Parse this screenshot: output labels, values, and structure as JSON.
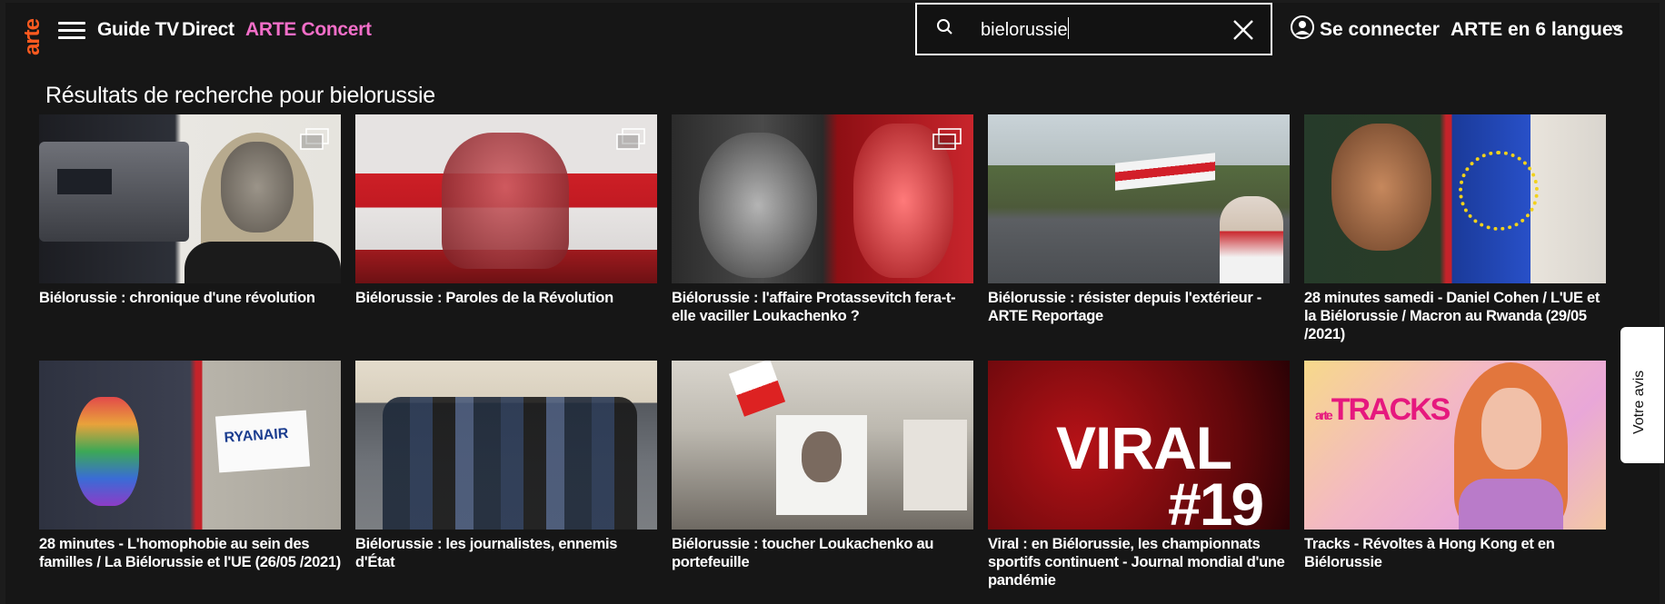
{
  "header": {
    "logo": "arte",
    "nav": [
      "Guide TV",
      "Direct",
      "ARTE Concert"
    ],
    "search_value": "bielorussie",
    "connect_label": "Se connecter",
    "lang_label": "ARTE en 6 langues"
  },
  "results_title": "Résultats de recherche pour bielorussie",
  "cards": [
    {
      "title": "Biélorussie : chronique d'une révolution",
      "has_collection_icon": true
    },
    {
      "title": "Biélorussie : Paroles de la Révolution",
      "has_collection_icon": true
    },
    {
      "title": "Biélorussie : l'affaire Protassevitch fera-t-elle vaciller Loukachenko ?",
      "has_collection_icon": true
    },
    {
      "title": "Biélorussie : résister depuis l'extérieur - ARTE Reportage",
      "has_collection_icon": false
    },
    {
      "title": "28 minutes samedi - Daniel Cohen / L'UE et la Biélorussie / Macron au Rwanda (29/05 /2021)",
      "has_collection_icon": false
    },
    {
      "title": "28 minutes - L'homophobie au sein des familles / La Biélorussie et l'UE (26/05 /2021)",
      "has_collection_icon": false
    },
    {
      "title": "Biélorussie : les journalistes, ennemis d'État",
      "has_collection_icon": false
    },
    {
      "title": "Biélorussie : toucher Loukachenko au portefeuille",
      "has_collection_icon": false
    },
    {
      "title": "Viral : en Biélorussie, les championnats sportifs continuent - Journal mondial d'une pandémie",
      "has_collection_icon": false
    },
    {
      "title": "Tracks - Révoltes à Hong Kong et en Biélorussie",
      "has_collection_icon": false
    }
  ],
  "thumb_text": {
    "ryanair": "RYANAIR",
    "viral": "VIRAL",
    "viral_num": "#19",
    "tracks_small": "arte",
    "tracks": "TRACKS"
  },
  "feedback_label": "Votre avis",
  "colors": {
    "logo": "#ff5a1f",
    "concert": "#f26ec8",
    "background": "#161616"
  }
}
